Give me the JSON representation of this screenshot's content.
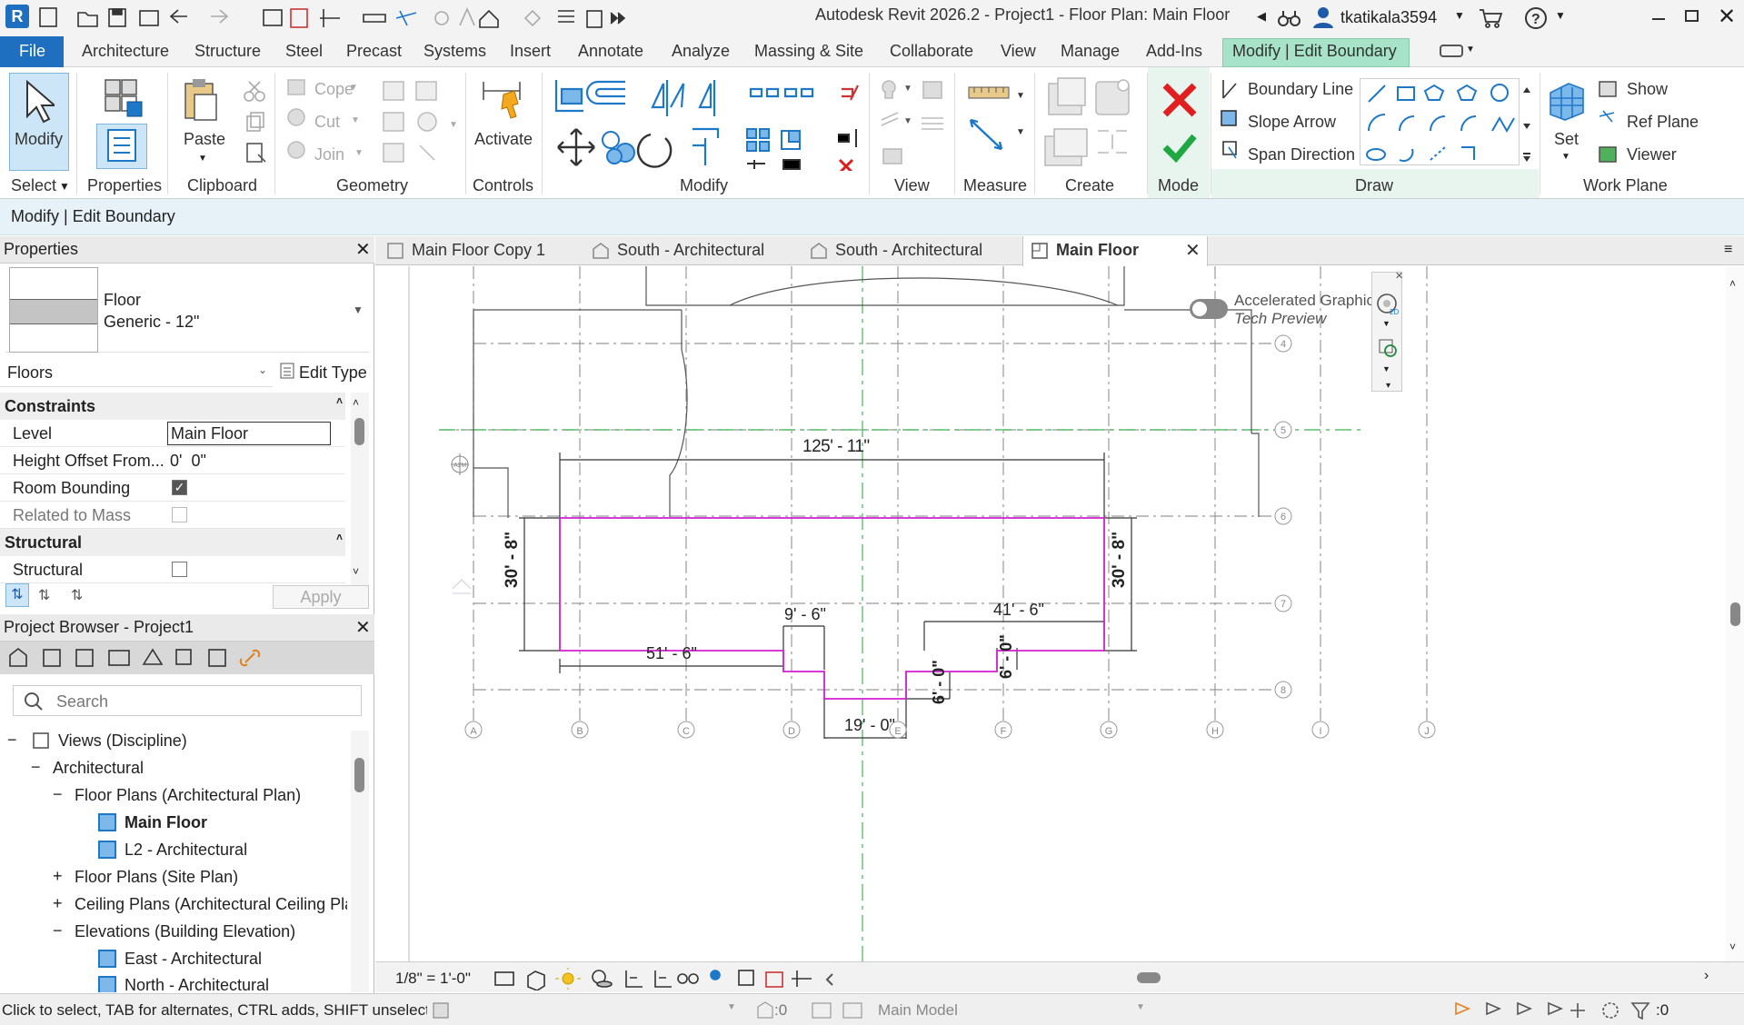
{
  "window": {
    "title": "Autodesk Revit 2026.2 - Project1 - Floor Plan: Main Floor",
    "user": "tkatikala3594"
  },
  "ribbon_tabs": [
    "File",
    "Architecture",
    "Structure",
    "Steel",
    "Precast",
    "Systems",
    "Insert",
    "Annotate",
    "Analyze",
    "Massing & Site",
    "Collaborate",
    "View",
    "Manage",
    "Add-Ins",
    "Modify | Edit Boundary"
  ],
  "ribbon": {
    "select": {
      "label": "Select"
    },
    "modify_btn": "Modify",
    "properties_btn": "Properties",
    "clipboard": {
      "paste": "Paste",
      "label": "Clipboard"
    },
    "geometry": {
      "cope": "Cope",
      "cut": "Cut",
      "join": "Join",
      "label": "Geometry"
    },
    "controls": {
      "activate": "Activate",
      "label": "Controls"
    },
    "modify_label": "Modify",
    "view_label": "View",
    "measure_label": "Measure",
    "create_label": "Create",
    "mode_label": "Mode",
    "draw": {
      "boundary_line": "Boundary Line",
      "slope_arrow": "Slope Arrow",
      "span_direction": "Span Direction",
      "label": "Draw"
    },
    "workplane": {
      "set": "Set",
      "show": "Show",
      "ref_plane": "Ref  Plane",
      "viewer": "Viewer",
      "label": "Work Plane"
    }
  },
  "context_bar": "Modify | Edit Boundary",
  "properties": {
    "title": "Properties",
    "type_line1": "Floor",
    "type_line2": "Generic - 12\"",
    "category": "Floors",
    "edit_type": "Edit Type",
    "constraints_header": "Constraints",
    "rows": [
      {
        "k": "Level",
        "v": "Main Floor"
      },
      {
        "k": "Height Offset From...",
        "v": "0'  0\""
      },
      {
        "k": "Room Bounding",
        "v": ""
      },
      {
        "k": "Related to Mass",
        "v": ""
      }
    ],
    "structural_header": "Structural",
    "structural_row": "Structural",
    "apply": "Apply"
  },
  "browser": {
    "title": "Project Browser - Project1",
    "search_placeholder": "Search",
    "items": [
      "Views (Discipline)",
      "Architectural",
      "Floor Plans (Architectural Plan)",
      "Main Floor",
      "L2 - Architectural",
      "Floor Plans (Site Plan)",
      "Ceiling Plans (Architectural Ceiling Pla",
      "Elevations (Building Elevation)",
      "East - Architectural",
      "North - Architectural"
    ]
  },
  "view_tabs": [
    "Main Floor Copy 1",
    "South - Architectural",
    "South - Architectural",
    "Main Floor"
  ],
  "canvas": {
    "accelerated_title": "Accelerated Graphics",
    "accelerated_sub": "Tech Preview",
    "grid_cols": [
      "A",
      "B",
      "C",
      "D",
      "E",
      "F",
      "G",
      "H",
      "I",
      "J"
    ],
    "grid_rows": [
      "4",
      "5",
      "6",
      "7",
      "8"
    ],
    "dims": {
      "top": "125' - 11\"",
      "left": "30' - 8\"",
      "right": "30' - 8\"",
      "d51": "51' - 6\"",
      "d9": "9' - 6\"",
      "d41": "41' - 6\"",
      "d19": "19' - 0\"",
      "d6a": "6' - 0\"",
      "d6b": "6' - 0\""
    }
  },
  "viewbar": {
    "scale": "1/8\" = 1'-0\""
  },
  "status": {
    "hint": "Click to select, TAB for alternates, CTRL adds, SHIFT unselect",
    "count": ":0",
    "model": "Main Model",
    "filter": ":0"
  },
  "colors": {
    "accent": "#1e78c8",
    "sketch": "#d21ed2",
    "ctx_tab": "#a6e3c8",
    "file_tab": "#1e6fbf"
  }
}
